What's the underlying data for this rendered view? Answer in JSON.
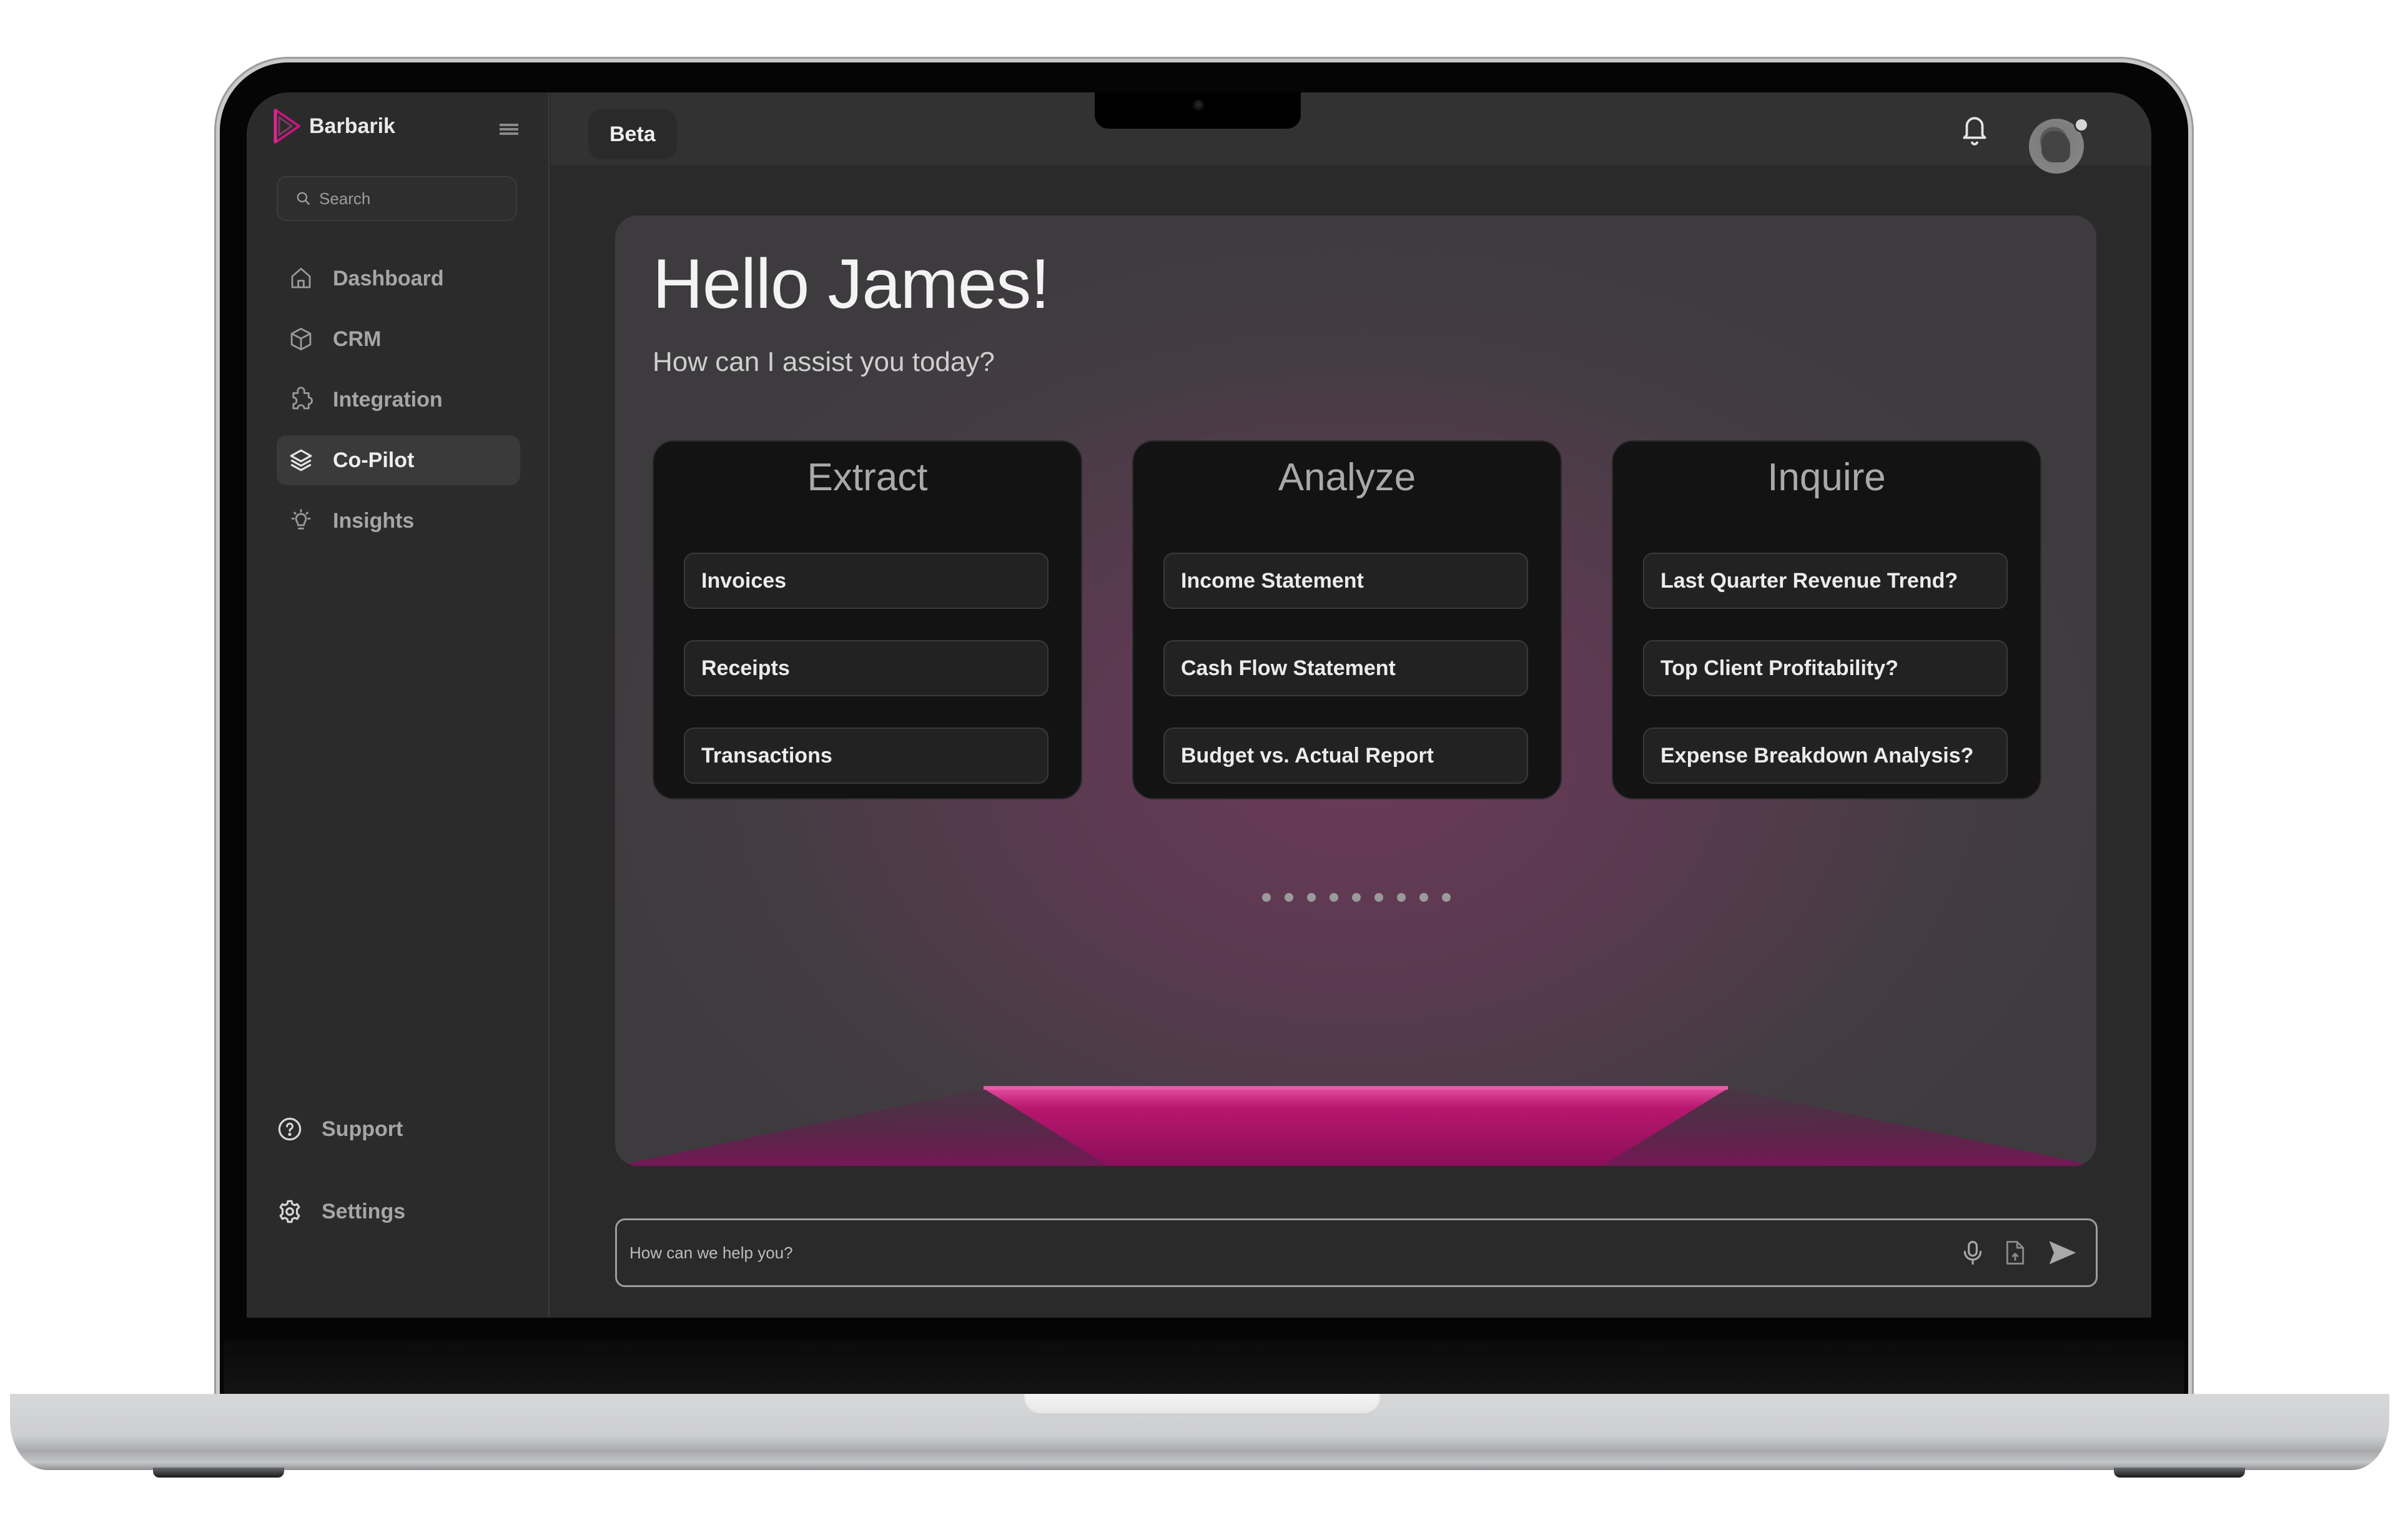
{
  "app": {
    "brand_name": "Barbarik",
    "accent_color": "#c2187a"
  },
  "sidebar": {
    "search_placeholder": "Search",
    "items": [
      {
        "label": "Dashboard",
        "icon": "home-icon",
        "active": false
      },
      {
        "label": "CRM",
        "icon": "cube-icon",
        "active": false
      },
      {
        "label": "Integration",
        "icon": "puzzle-icon",
        "active": false
      },
      {
        "label": "Co-Pilot",
        "icon": "layers-icon",
        "active": true
      },
      {
        "label": "Insights",
        "icon": "lightbulb-icon",
        "active": false
      }
    ],
    "bottom_items": [
      {
        "label": "Support",
        "icon": "help-circle-icon"
      },
      {
        "label": "Settings",
        "icon": "gear-icon"
      }
    ]
  },
  "header": {
    "badge": "Beta",
    "notifications_icon": "bell-icon",
    "avatar_status": "online"
  },
  "hero": {
    "greeting": "Hello James!",
    "subtitle": "How can I assist you today?",
    "cards": [
      {
        "title": "Extract",
        "actions": [
          "Invoices",
          "Receipts",
          "Transactions"
        ]
      },
      {
        "title": "Analyze",
        "actions": [
          "Income Statement",
          "Cash Flow Statement",
          "Budget vs. Actual Report"
        ]
      },
      {
        "title": "Inquire",
        "actions": [
          "Last Quarter Revenue Trend?",
          "Top Client Profitability?",
          "Expense Breakdown Analysis?"
        ]
      }
    ],
    "pagination_dots": 9
  },
  "chat": {
    "placeholder": "How can we help you?",
    "value": "",
    "icons": [
      "microphone-icon",
      "file-upload-icon",
      "send-icon"
    ]
  }
}
